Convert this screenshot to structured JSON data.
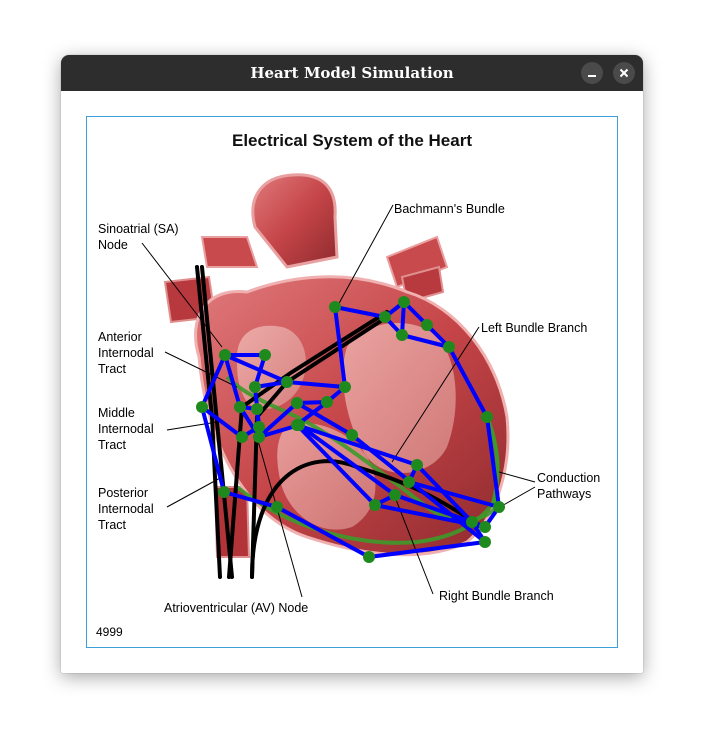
{
  "window": {
    "title": "Heart Model Simulation",
    "buttons": {
      "minimize": "minimize-icon",
      "close": "close-icon"
    }
  },
  "figure": {
    "title": "Electrical System of the Heart",
    "labels": {
      "sa_node": [
        "Sinoatrial (SA)",
        "Node"
      ],
      "anterior": [
        "Anterior",
        "Internodal",
        "Tract"
      ],
      "middle": [
        "Middle",
        "Internodal",
        "Tract"
      ],
      "posterior": [
        "Posterior",
        "Internodal",
        "Tract"
      ],
      "av_node": "Atrioventricular (AV) Node",
      "bachmann": "Bachmann's Bundle",
      "left_bundle": "Left Bundle Branch",
      "right_bundle": "Right Bundle Branch",
      "conduction": [
        "Conduction",
        "Pathways"
      ]
    },
    "counter": "4999",
    "colors": {
      "graph_edges": "#0000ff",
      "graph_nodes": "#1e8a1e",
      "paths": "#000000",
      "frame": "#3ea0d8",
      "heart": "#c94a4e"
    }
  }
}
